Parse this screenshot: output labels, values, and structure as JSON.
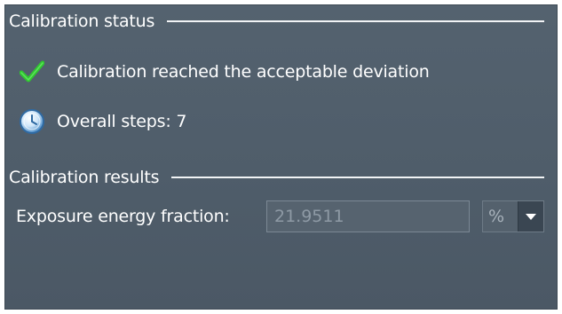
{
  "calibration_status": {
    "title": "Calibration status",
    "items": [
      {
        "icon": "checkmark-icon",
        "text": "Calibration reached the acceptable deviation",
        "color": "#33cc33"
      },
      {
        "icon": "clock-icon",
        "text": "Overall steps: 7",
        "color": "#7fb6e6"
      }
    ]
  },
  "calibration_results": {
    "title": "Calibration results",
    "exposure_label": "Exposure energy fraction:",
    "exposure_value": "21.9511",
    "unit_value": "%"
  }
}
